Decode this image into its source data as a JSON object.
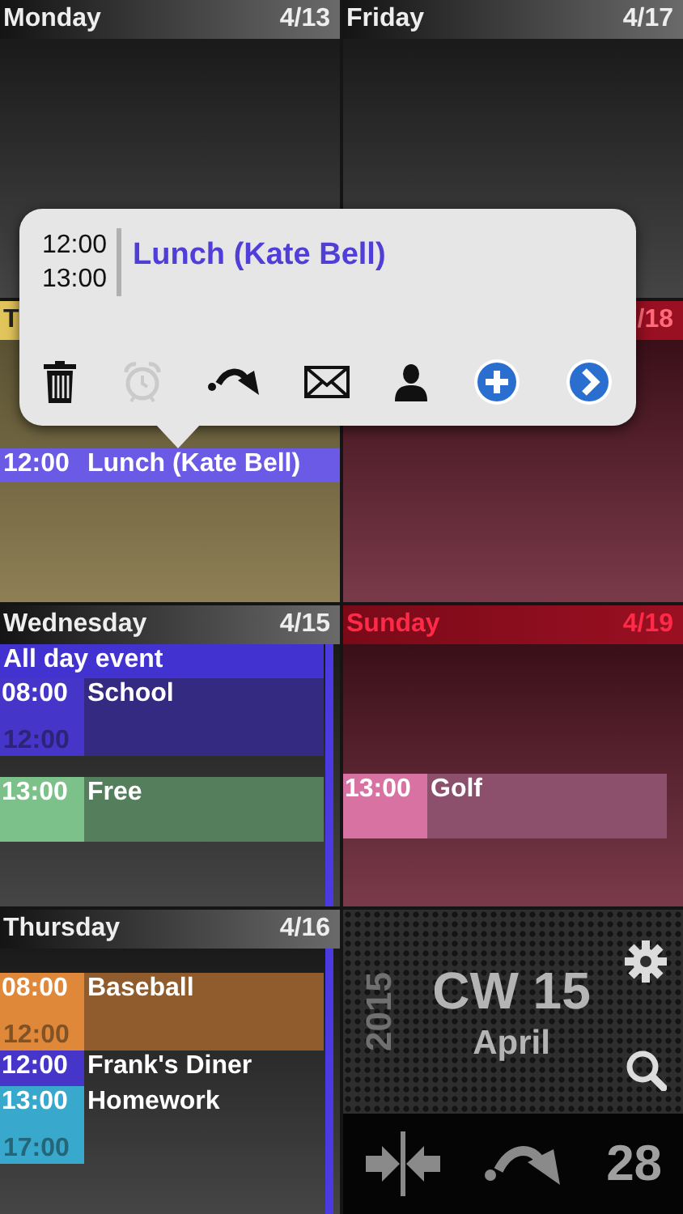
{
  "days": [
    {
      "kind": "weekday",
      "name": "Monday",
      "date": "4/13",
      "scrollbar": false
    },
    {
      "kind": "weekday",
      "name": "Friday",
      "date": "4/17",
      "scrollbar": false
    },
    {
      "kind": "today",
      "name": "T",
      "scrollbar": false,
      "events": [
        {
          "kind": "bar",
          "start": "12:00",
          "title": "Lunch (Kate Bell)",
          "color": "#6a5ae6"
        }
      ]
    },
    {
      "kind": "weekend",
      "date": "/18",
      "scrollbar": false
    },
    {
      "kind": "weekday",
      "name": "Wednesday",
      "date": "4/15",
      "scrollbar": true,
      "events": [
        {
          "kind": "allday",
          "title": "All day event",
          "color": "#4232d0"
        },
        {
          "kind": "block",
          "start": "08:00",
          "end": "12:00",
          "title": "School",
          "color": "#4535c8"
        },
        {
          "kind": "block",
          "start": "13:00",
          "title": "Free",
          "color": "#7cc08a"
        }
      ]
    },
    {
      "kind": "weekend",
      "name": "Sunday",
      "date": "4/19",
      "scrollbar": false,
      "events": [
        {
          "kind": "block",
          "start": "13:00",
          "title": "Golf",
          "color": "#d872a2"
        }
      ]
    },
    {
      "kind": "weekday",
      "name": "Thursday",
      "date": "4/16",
      "scrollbar": true,
      "events": [
        {
          "kind": "block",
          "start": "08:00",
          "end": "12:00",
          "title": "Baseball",
          "color": "#e0883a"
        },
        {
          "kind": "line",
          "start": "12:00",
          "title": "Frank's Diner",
          "color": "#4535c8"
        },
        {
          "kind": "line",
          "start": "13:00",
          "end": "17:00",
          "title": "Homework",
          "color": "#38a8cc"
        }
      ]
    }
  ],
  "week_panel": {
    "year": "2015",
    "week": "CW 15",
    "month": "April",
    "day": "28"
  },
  "popup": {
    "start": "12:00",
    "end": "13:00",
    "title": "Lunch (Kate Bell)",
    "actions": [
      {
        "kind": "delete",
        "disabled": false
      },
      {
        "kind": "alarm",
        "disabled": true
      },
      {
        "kind": "move",
        "disabled": false
      },
      {
        "kind": "mail",
        "disabled": false
      },
      {
        "kind": "contact",
        "disabled": false
      },
      {
        "kind": "add",
        "disabled": false
      },
      {
        "kind": "details",
        "disabled": false
      }
    ]
  }
}
